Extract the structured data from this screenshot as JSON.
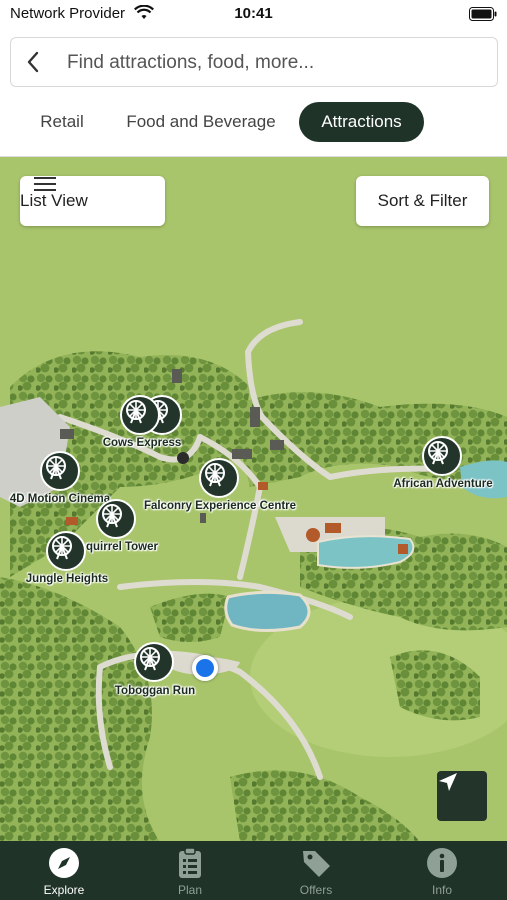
{
  "status_bar": {
    "carrier": "Network Provider",
    "time": "10:41"
  },
  "search": {
    "placeholder": "Find attractions, food, more..."
  },
  "category_tabs": [
    {
      "label": "Retail",
      "active": false
    },
    {
      "label": "Food and Beverage",
      "active": false
    },
    {
      "label": "Attractions",
      "active": true
    }
  ],
  "map_controls": {
    "list_view_label": "List View",
    "sort_filter_label": "Sort & Filter"
  },
  "attractions": [
    {
      "name": "Cows Express"
    },
    {
      "name": "4D Motion Cinema"
    },
    {
      "name": "Falconry Experience Centre"
    },
    {
      "name": "African Adventure"
    },
    {
      "name": "quirrel Tower"
    },
    {
      "name": "Jungle Heights"
    },
    {
      "name": "Toboggan Run"
    }
  ],
  "bottom_nav": [
    {
      "label": "Explore",
      "icon": "compass-icon",
      "active": true
    },
    {
      "label": "Plan",
      "icon": "clipboard-icon",
      "active": false
    },
    {
      "label": "Offers",
      "icon": "tag-icon",
      "active": false
    },
    {
      "label": "Info",
      "icon": "info-icon",
      "active": false
    }
  ],
  "colors": {
    "nav_dark": "#1f3328",
    "map_grass": "#a8c468",
    "user_location": "#1a73e8"
  }
}
